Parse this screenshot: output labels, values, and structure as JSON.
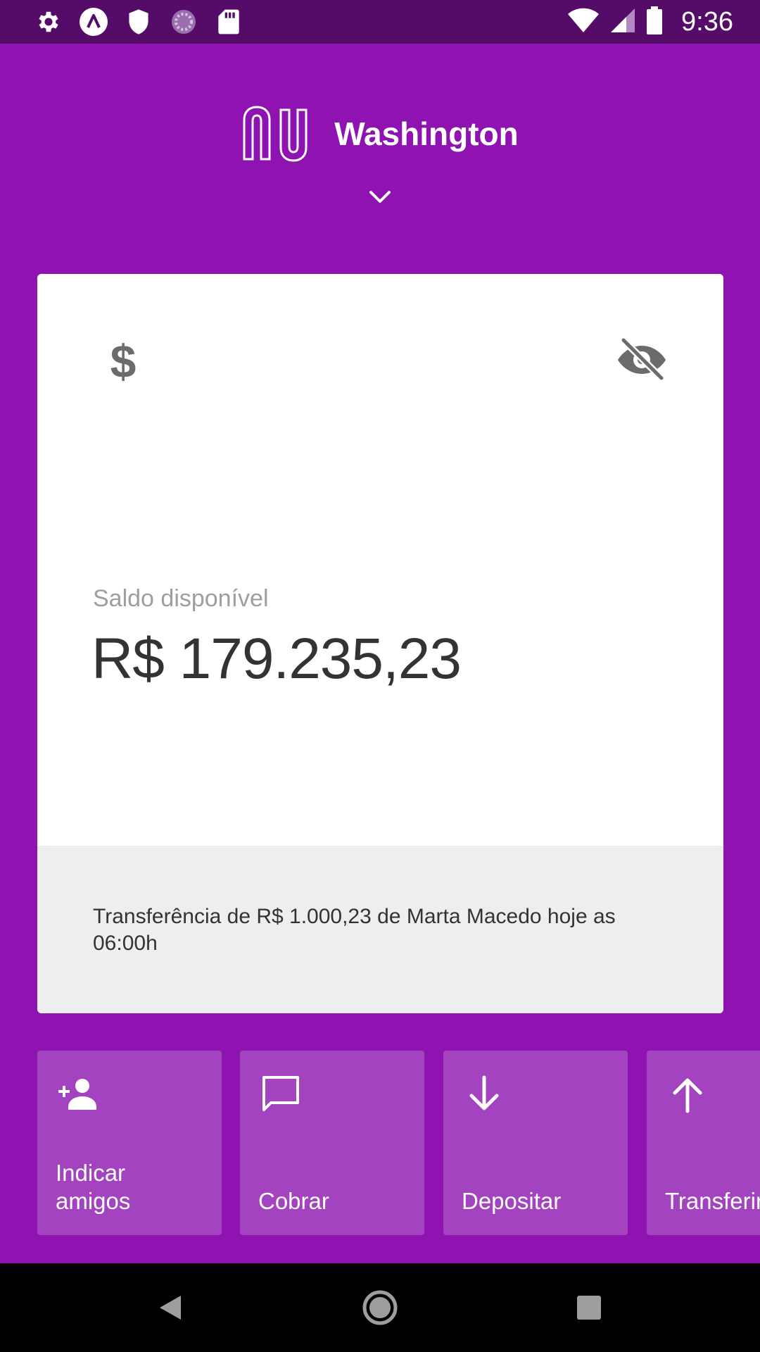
{
  "status_bar": {
    "time": "9:36",
    "left_icons": [
      "settings-icon",
      "app-a-icon",
      "shield-icon",
      "sync-icon",
      "sd-card-icon"
    ],
    "right_icons": [
      "wifi-icon",
      "signal-icon",
      "battery-icon"
    ]
  },
  "header": {
    "brand": "nu",
    "user_name": "Washington"
  },
  "account_card": {
    "balance_label": "Saldo disponível",
    "balance_value": "R$ 179.235,23",
    "notification": "Transferência de R$ 1.000,23 de Marta Macedo hoje as 06:00h"
  },
  "actions": [
    {
      "label": "Indicar\namigos",
      "icon": "add-person-icon"
    },
    {
      "label": "Cobrar",
      "icon": "chat-bubble-icon"
    },
    {
      "label": "Depositar",
      "icon": "arrow-down-icon"
    },
    {
      "label": "Transferir",
      "icon": "arrow-up-icon"
    }
  ],
  "colors": {
    "background": "#8e13b0",
    "status_bar": "#550b68",
    "action_tile": "#a443bf",
    "card": "#ffffff",
    "card_footer": "#eeeeee"
  }
}
